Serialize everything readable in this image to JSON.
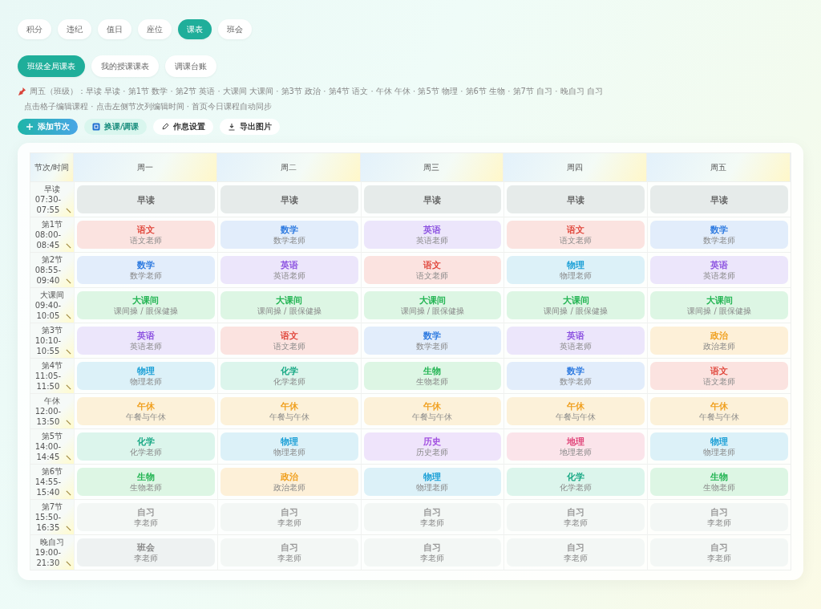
{
  "main_tabs": [
    {
      "label": "积分",
      "selected": false
    },
    {
      "label": "违纪",
      "selected": false
    },
    {
      "label": "值日",
      "selected": false
    },
    {
      "label": "座位",
      "selected": false
    },
    {
      "label": "课表",
      "selected": true
    },
    {
      "label": "班会",
      "selected": false
    }
  ],
  "sub_tabs": [
    {
      "label": "班级全局课表",
      "selected": true
    },
    {
      "label": "我的授课课表",
      "selected": false
    },
    {
      "label": "调课台账",
      "selected": false
    }
  ],
  "today_summary": "周五（班级）：早读 早读 · 第1节 数学 · 第2节 英语 · 大课间 大课间 · 第3节 政治 · 第4节 语文 · 午休 午休 · 第5节 物理 · 第6节 生物 · 第7节 自习 · 晚自习 自习",
  "hint": "点击格子编辑课程 · 点击左侧节次列编辑时间 · 首页今日课程自动同步",
  "toolbar": [
    {
      "label": "添加节次",
      "kind": "primary"
    },
    {
      "label": "换课/调课",
      "kind": "swap"
    },
    {
      "label": "作息设置",
      "kind": "edit"
    },
    {
      "label": "导出图片",
      "kind": "download"
    }
  ],
  "table": {
    "corner": "节次/时间",
    "days": [
      "周一",
      "周二",
      "周三",
      "周四",
      "周五"
    ],
    "rows": [
      {
        "period": "早读",
        "time": "07:30-07:55",
        "cells": [
          {
            "subject": "早读",
            "kind": "reading"
          },
          {
            "subject": "早读",
            "kind": "reading"
          },
          {
            "subject": "早读",
            "kind": "reading"
          },
          {
            "subject": "早读",
            "kind": "reading"
          },
          {
            "subject": "早读",
            "kind": "reading"
          }
        ]
      },
      {
        "period": "第1节",
        "time": "08:00-08:45",
        "cells": [
          {
            "subject": "语文",
            "note": "语文老师",
            "kind": "chinese"
          },
          {
            "subject": "数学",
            "note": "数学老师",
            "kind": "math"
          },
          {
            "subject": "英语",
            "note": "英语老师",
            "kind": "english"
          },
          {
            "subject": "语文",
            "note": "语文老师",
            "kind": "chinese"
          },
          {
            "subject": "数学",
            "note": "数学老师",
            "kind": "math"
          }
        ]
      },
      {
        "period": "第2节",
        "time": "08:55-09:40",
        "cells": [
          {
            "subject": "数学",
            "note": "数学老师",
            "kind": "math"
          },
          {
            "subject": "英语",
            "note": "英语老师",
            "kind": "english"
          },
          {
            "subject": "语文",
            "note": "语文老师",
            "kind": "chinese"
          },
          {
            "subject": "物理",
            "note": "物理老师",
            "kind": "physics"
          },
          {
            "subject": "英语",
            "note": "英语老师",
            "kind": "english"
          }
        ]
      },
      {
        "period": "大课间",
        "time": "09:40-10:05",
        "cells": [
          {
            "subject": "大课间",
            "note": "课间操 / 眼保健操",
            "kind": "break"
          },
          {
            "subject": "大课间",
            "note": "课间操 / 眼保健操",
            "kind": "break"
          },
          {
            "subject": "大课间",
            "note": "课间操 / 眼保健操",
            "kind": "break"
          },
          {
            "subject": "大课间",
            "note": "课间操 / 眼保健操",
            "kind": "break"
          },
          {
            "subject": "大课间",
            "note": "课间操 / 眼保健操",
            "kind": "break"
          }
        ]
      },
      {
        "period": "第3节",
        "time": "10:10-10:55",
        "cells": [
          {
            "subject": "英语",
            "note": "英语老师",
            "kind": "english"
          },
          {
            "subject": "语文",
            "note": "语文老师",
            "kind": "chinese"
          },
          {
            "subject": "数学",
            "note": "数学老师",
            "kind": "math"
          },
          {
            "subject": "英语",
            "note": "英语老师",
            "kind": "english"
          },
          {
            "subject": "政治",
            "note": "政治老师",
            "kind": "politics"
          }
        ]
      },
      {
        "period": "第4节",
        "time": "11:05-11:50",
        "cells": [
          {
            "subject": "物理",
            "note": "物理老师",
            "kind": "physics"
          },
          {
            "subject": "化学",
            "note": "化学老师",
            "kind": "chemistry"
          },
          {
            "subject": "生物",
            "note": "生物老师",
            "kind": "biology"
          },
          {
            "subject": "数学",
            "note": "数学老师",
            "kind": "math"
          },
          {
            "subject": "语文",
            "note": "语文老师",
            "kind": "chinese"
          }
        ]
      },
      {
        "period": "午休",
        "time": "12:00-13:50",
        "cells": [
          {
            "subject": "午休",
            "note": "午餐与午休",
            "kind": "lunch"
          },
          {
            "subject": "午休",
            "note": "午餐与午休",
            "kind": "lunch"
          },
          {
            "subject": "午休",
            "note": "午餐与午休",
            "kind": "lunch"
          },
          {
            "subject": "午休",
            "note": "午餐与午休",
            "kind": "lunch"
          },
          {
            "subject": "午休",
            "note": "午餐与午休",
            "kind": "lunch"
          }
        ]
      },
      {
        "period": "第5节",
        "time": "14:00-14:45",
        "cells": [
          {
            "subject": "化学",
            "note": "化学老师",
            "kind": "chemistry"
          },
          {
            "subject": "物理",
            "note": "物理老师",
            "kind": "physics"
          },
          {
            "subject": "历史",
            "note": "历史老师",
            "kind": "history"
          },
          {
            "subject": "地理",
            "note": "地理老师",
            "kind": "geography"
          },
          {
            "subject": "物理",
            "note": "物理老师",
            "kind": "physics"
          }
        ]
      },
      {
        "period": "第6节",
        "time": "14:55-15:40",
        "cells": [
          {
            "subject": "生物",
            "note": "生物老师",
            "kind": "biology"
          },
          {
            "subject": "政治",
            "note": "政治老师",
            "kind": "politics"
          },
          {
            "subject": "物理",
            "note": "物理老师",
            "kind": "physics"
          },
          {
            "subject": "化学",
            "note": "化学老师",
            "kind": "chemistry"
          },
          {
            "subject": "生物",
            "note": "生物老师",
            "kind": "biology"
          }
        ]
      },
      {
        "period": "第7节",
        "time": "15:50-16:35",
        "cells": [
          {
            "subject": "自习",
            "note": "李老师",
            "kind": "study"
          },
          {
            "subject": "自习",
            "note": "李老师",
            "kind": "study"
          },
          {
            "subject": "自习",
            "note": "李老师",
            "kind": "study"
          },
          {
            "subject": "自习",
            "note": "李老师",
            "kind": "study"
          },
          {
            "subject": "自习",
            "note": "李老师",
            "kind": "study"
          }
        ]
      },
      {
        "period": "晚自习",
        "time": "19:00-21:30",
        "cells": [
          {
            "subject": "班会",
            "note": "李老师",
            "kind": "meeting"
          },
          {
            "subject": "自习",
            "note": "李老师",
            "kind": "study"
          },
          {
            "subject": "自习",
            "note": "李老师",
            "kind": "study"
          },
          {
            "subject": "自习",
            "note": "李老师",
            "kind": "study"
          },
          {
            "subject": "自习",
            "note": "李老师",
            "kind": "study"
          }
        ]
      }
    ]
  }
}
